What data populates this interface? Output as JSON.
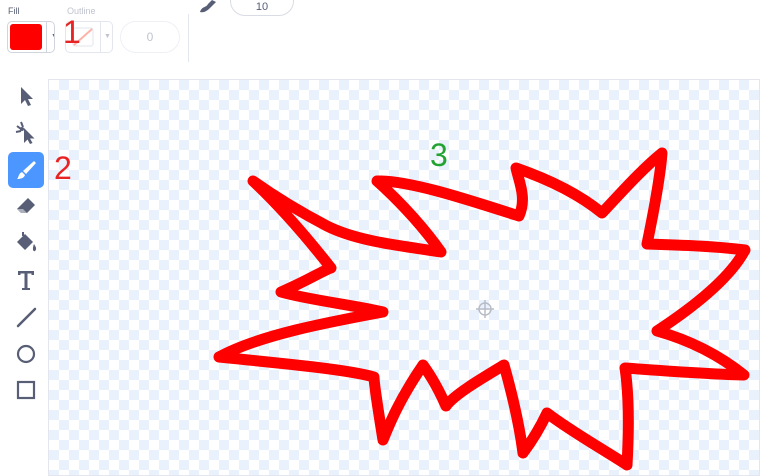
{
  "toolbar": {
    "fill_label": "Fill",
    "outline_label": "Outline",
    "fill_color": "#ff0000",
    "outline_width": "0",
    "brush_size": "10"
  },
  "annotations": {
    "one": "1",
    "two": "2",
    "three": "3"
  },
  "tools": [
    {
      "name": "select",
      "icon": "select-arrow-icon",
      "selected": false
    },
    {
      "name": "reshape",
      "icon": "reshape-icon",
      "selected": false
    },
    {
      "name": "brush",
      "icon": "brush-icon",
      "selected": true
    },
    {
      "name": "eraser",
      "icon": "eraser-icon",
      "selected": false
    },
    {
      "name": "fill",
      "icon": "paint-bucket-icon",
      "selected": false
    },
    {
      "name": "text",
      "icon": "text-icon",
      "selected": false
    },
    {
      "name": "line",
      "icon": "line-icon",
      "selected": false
    },
    {
      "name": "circle",
      "icon": "circle-icon",
      "selected": false
    },
    {
      "name": "rectangle",
      "icon": "rectangle-icon",
      "selected": false
    }
  ],
  "colors": {
    "accent": "#4c97ff",
    "stroke": "#ff0000",
    "icon": "#575e75"
  }
}
